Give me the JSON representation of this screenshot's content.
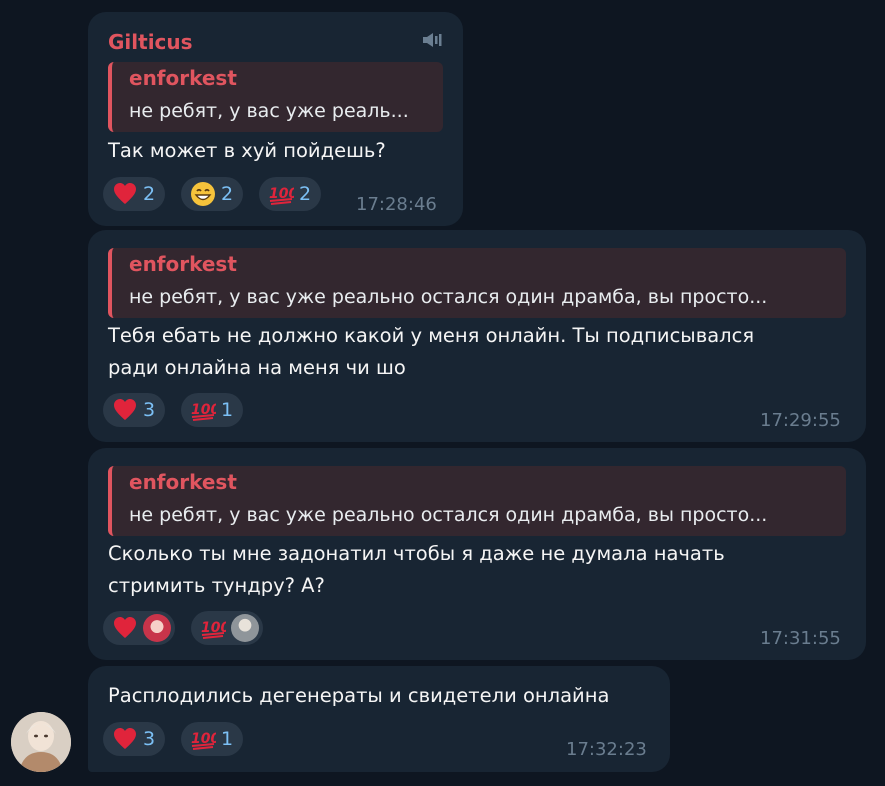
{
  "messages": [
    {
      "sender": "Gilticus",
      "reply_name": "enforkest",
      "reply_text": "не ребят, у вас уже реаль...",
      "text_lines": [
        "Так может в хуй пойдешь?"
      ],
      "reactions": [
        {
          "emoji": "heart-emoji",
          "count": "2"
        },
        {
          "emoji": "grinning-face-emoji",
          "count": "2"
        },
        {
          "emoji": "hundred-points-emoji",
          "count": "2"
        }
      ],
      "time": "17:28:46"
    },
    {
      "reply_name": "enforkest",
      "reply_text": "не ребят, у вас уже реально остался один драмба, вы просто...",
      "text_lines": [
        "Тебя ебать не должно какой у меня онлайн. Ты подписывался",
        "ради онлайна на меня чи шо"
      ],
      "reactions": [
        {
          "emoji": "heart-emoji",
          "count": "3"
        },
        {
          "emoji": "hundred-points-emoji",
          "count": "1"
        }
      ],
      "time": "17:29:55"
    },
    {
      "reply_name": "enforkest",
      "reply_text": "не ребят, у вас уже реально остался один драмба, вы просто...",
      "text_lines": [
        "Сколько ты мне задонатил чтобы я даже не думала начать",
        "стримить тундру? А?"
      ],
      "reactions": [
        {
          "emoji": "heart-emoji",
          "reactor": "anime-avatar"
        },
        {
          "emoji": "hundred-points-emoji",
          "reactor": "user-photo-avatar"
        }
      ],
      "time": "17:31:55"
    },
    {
      "text_lines": [
        "Расплодились дегенераты и свидетели онлайна"
      ],
      "reactions": [
        {
          "emoji": "heart-emoji",
          "count": "3"
        },
        {
          "emoji": "hundred-points-emoji",
          "count": "1"
        }
      ],
      "time": "17:32:23"
    }
  ],
  "colors": {
    "background": "#0e1621",
    "bubble": "#182533",
    "accent": "#e0555f",
    "reaction_bg": "#2a3847",
    "reaction_count": "#7cc0f5",
    "timestamp": "#6a7d8f"
  }
}
